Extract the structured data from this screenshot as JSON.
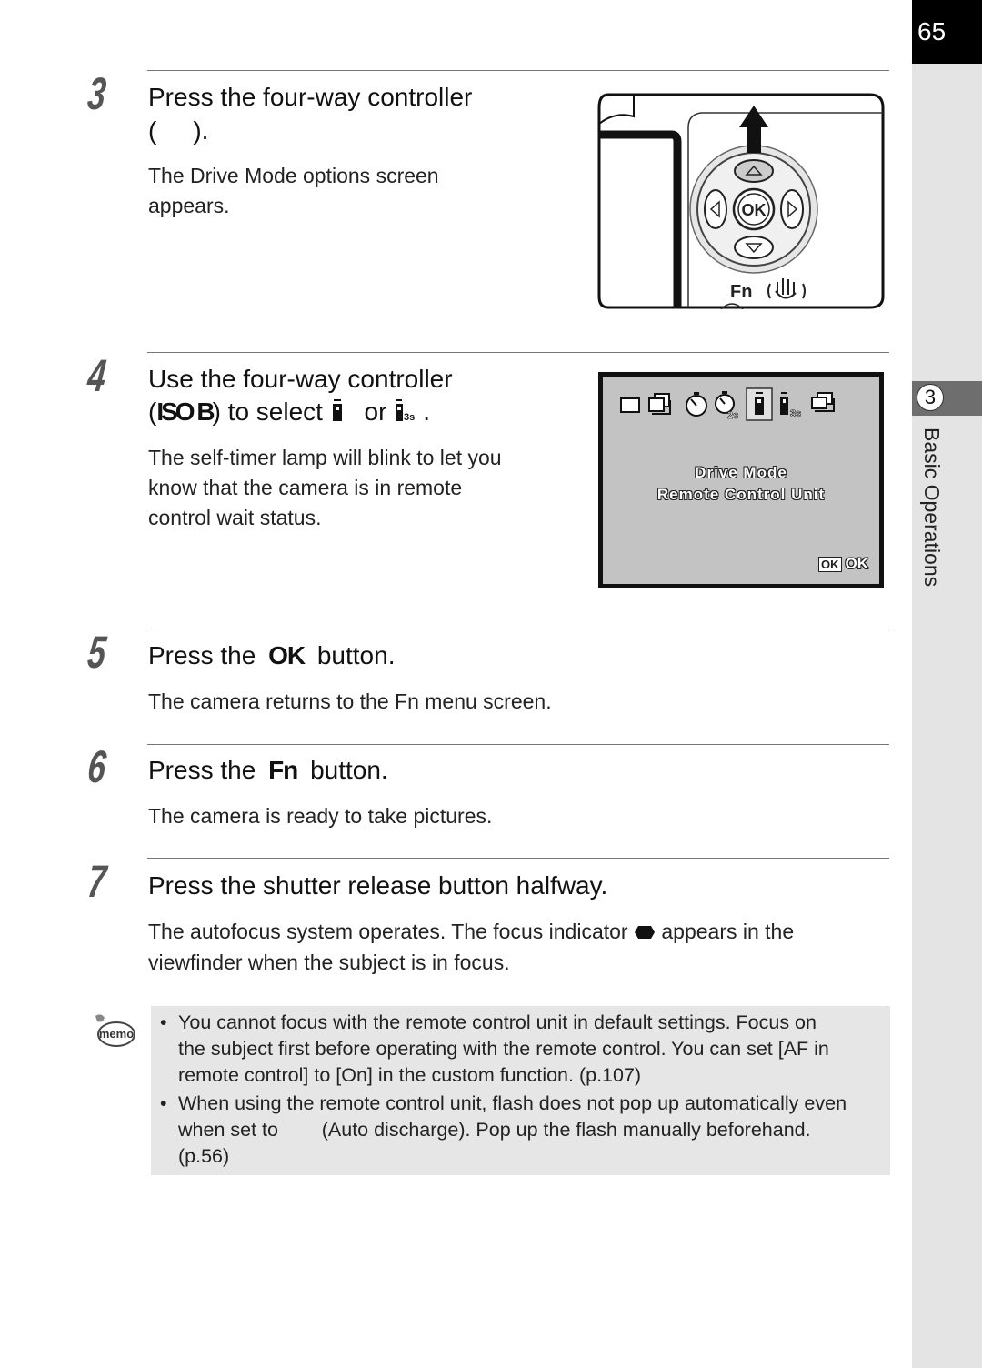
{
  "page": {
    "number": "65",
    "chapter_number": "3",
    "chapter_title": "Basic Operations"
  },
  "steps": [
    {
      "number": "3",
      "heading_line1": "Press the four-way controller",
      "heading_line2_prefix": "(",
      "heading_line2_icon": "up-arrow-icon",
      "heading_line2_suffix": ").",
      "body": [
        "The Drive Mode options screen",
        "appears."
      ]
    },
    {
      "number": "4",
      "heading_line1": "Use the four-way controller",
      "heading_line2_prefix": "(",
      "heading_line2_icon_text": "ISO B",
      "heading_line2_mid": ") to select",
      "heading_line2_or": "or",
      "heading_line2_end": ".",
      "body": [
        "The self-timer lamp will blink to let you",
        "know that the camera is in remote",
        "control wait status."
      ]
    },
    {
      "number": "5",
      "heading_prefix": "Press the",
      "heading_icon_text": "OK",
      "heading_suffix": "button.",
      "body": [
        "The camera returns to the Fn menu screen."
      ]
    },
    {
      "number": "6",
      "heading_prefix": "Press the",
      "heading_icon_text": "Fn",
      "heading_suffix": "button.",
      "body": [
        "The camera is ready to take pictures."
      ]
    },
    {
      "number": "7",
      "heading": "Press the shutter release button halfway.",
      "body_line1_prefix": "The autofocus system operates. The focus indicator",
      "body_line1_suffix": "appears in the",
      "body_line2": "viewfinder when the subject is in focus."
    }
  ],
  "camera_illustration": {
    "ok_label": "OK",
    "fn_label": "Fn"
  },
  "lcd_screen": {
    "icons": [
      "single-frame-icon",
      "continuous-icon",
      "self-timer-12s-icon",
      "self-timer-2s-icon",
      "remote-control-icon",
      "remote-control-3s-icon",
      "auto-bracket-icon"
    ],
    "title": "Drive Mode",
    "subtitle": "Remote Control Unit",
    "ok_box": "OK",
    "ok_label": "OK"
  },
  "memo": {
    "icon_label": "memo",
    "bullet": "•",
    "items": [
      [
        "You cannot focus with the remote control unit in default settings. Focus on",
        "the subject first before operating with the remote control. You can set [AF in",
        "remote control] to [On] in the custom function. (p.107)"
      ],
      [
        "When using the remote control unit, flash does not pop up automatically even",
        "when set to        (Auto discharge). Pop up the flash manually beforehand.",
        "(p.56)"
      ]
    ]
  }
}
